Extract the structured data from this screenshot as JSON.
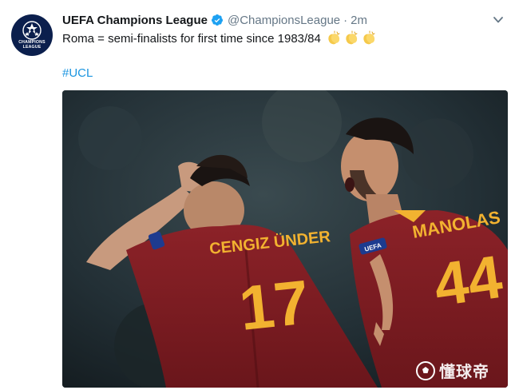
{
  "account": {
    "display_name": "UEFA Champions League",
    "handle": "@ChampionsLeague",
    "separator": "·",
    "time": "2m",
    "avatar_text_line1": "CHAMPIONS",
    "avatar_text_line2": "LEAGUE",
    "verified": true
  },
  "tweet": {
    "text": "Roma = semi-finalists for first time since 1983/84",
    "emoji": [
      "clapping-hands",
      "clapping-hands",
      "clapping-hands"
    ],
    "hashtag": "#UCL"
  },
  "media": {
    "player_left_name": "CENGIZ ÜNDER",
    "player_left_number": "17",
    "player_right_name": "MANOLAS",
    "player_right_number": "44",
    "patch_text": "UEFA"
  },
  "watermark": {
    "text": "懂球帝"
  },
  "colors": {
    "link": "#1b95e0",
    "muted": "#657786",
    "verified": "#1da1f2",
    "jersey": "#7d1a1f",
    "jersey_text": "#f2b230"
  },
  "icons": {
    "verified": "verified-badge-icon",
    "caret": "chevron-down-icon",
    "clap": "clapping-hands-icon",
    "watermark": "soccer-ball-icon"
  }
}
